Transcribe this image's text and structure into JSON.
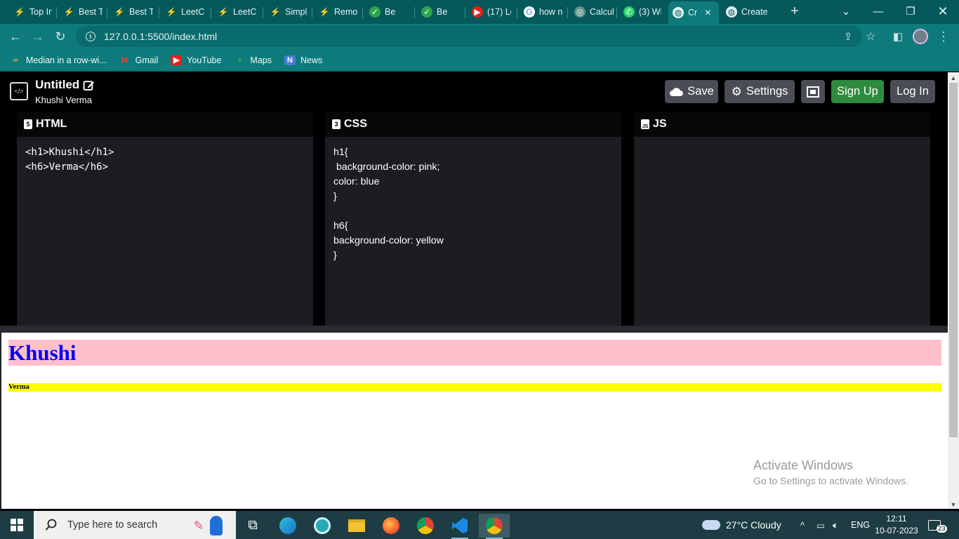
{
  "browser": {
    "tabs": [
      {
        "title": "Top In",
        "icon": "codingninjas-icon"
      },
      {
        "title": "Best T",
        "icon": "codingninjas-icon"
      },
      {
        "title": "Best T",
        "icon": "codingninjas-icon"
      },
      {
        "title": "LeetC",
        "icon": "leetcode-icon"
      },
      {
        "title": "LeetC",
        "icon": "leetcode-icon"
      },
      {
        "title": "Simpl",
        "icon": "leetcode-icon"
      },
      {
        "title": "Remo",
        "icon": "leetcode-icon"
      },
      {
        "title": "Be",
        "icon": "checkbox-icon"
      },
      {
        "title": "Be",
        "icon": "checkbox-icon"
      },
      {
        "title": "(17) Le",
        "icon": "youtube-icon"
      },
      {
        "title": "how n",
        "icon": "google-icon"
      },
      {
        "title": "Calcul",
        "icon": "chatgpt-icon"
      },
      {
        "title": "(3) WI",
        "icon": "whatsapp-icon"
      },
      {
        "title": "Cr",
        "icon": "globe-icon",
        "active": true
      },
      {
        "title": "Create",
        "icon": "globe-icon"
      }
    ],
    "url": "127.0.0.1:5500/index.html",
    "bookmarks": [
      {
        "label": "Median in a row-wi...",
        "icon": "codingninjas-icon"
      },
      {
        "label": "Gmail",
        "icon": "gmail-icon"
      },
      {
        "label": "YouTube",
        "icon": "youtube-icon"
      },
      {
        "label": "Maps",
        "icon": "maps-icon"
      },
      {
        "label": "News",
        "icon": "news-icon"
      }
    ]
  },
  "app": {
    "project_title": "Untitled",
    "author": "Khushi Verma",
    "buttons": {
      "save": "Save",
      "settings": "Settings",
      "signup": "Sign Up",
      "login": "Log In"
    },
    "colors": {
      "signup": "#2e8b3e",
      "button": "#4a4d55"
    }
  },
  "editors": {
    "html": {
      "label": "HTML",
      "code": "<h1>Khushi</h1>\n<h6>Verma</h6>"
    },
    "css": {
      "label": "CSS",
      "code": "h1{\n background-color: pink;\ncolor: blue\n}\n\nh6{\nbackground-color: yellow\n}"
    },
    "js": {
      "label": "JS",
      "code": ""
    }
  },
  "output": {
    "h1": "Khushi",
    "h6": "Verma"
  },
  "watermark": {
    "line1": "Activate Windows",
    "line2": "Go to Settings to activate Windows."
  },
  "taskbar": {
    "search_placeholder": "Type here to search",
    "weather": "27°C  Cloudy",
    "language": "ENG",
    "time": "12:11",
    "date": "10-07-2023",
    "notifications": "23"
  }
}
